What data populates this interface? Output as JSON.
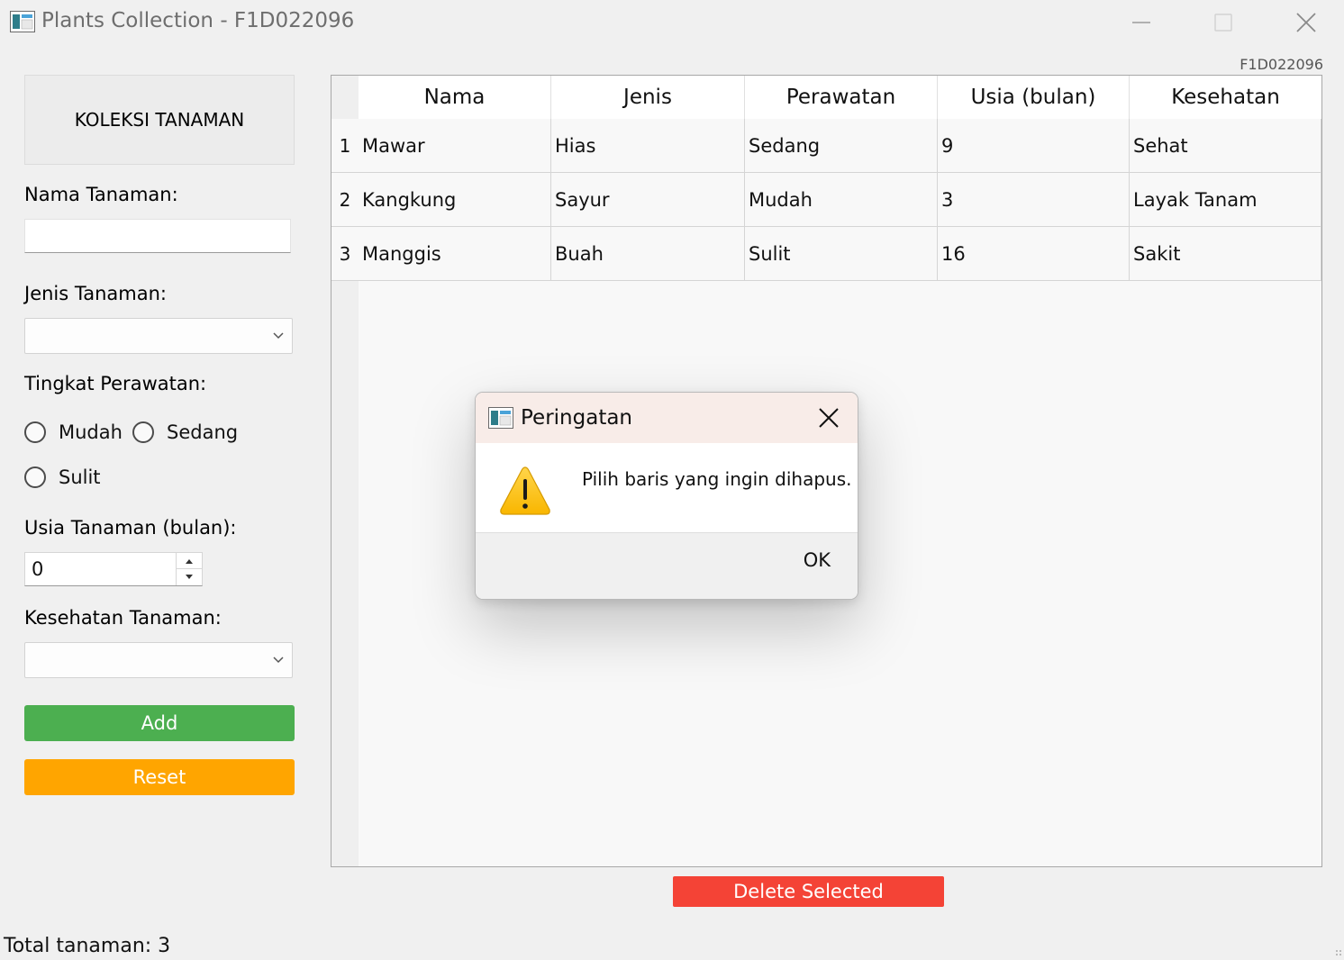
{
  "window": {
    "title": "Plants Collection - F1D022096",
    "icon": "app-window-icon"
  },
  "watermark": "F1D022096",
  "form": {
    "header": "KOLEKSI TANAMAN",
    "nama_label": "Nama Tanaman:",
    "nama_value": "",
    "jenis_label": "Jenis Tanaman:",
    "jenis_value": "",
    "perawatan_label": "Tingkat Perawatan:",
    "perawatan_options": [
      "Mudah",
      "Sedang",
      "Sulit"
    ],
    "usia_label": "Usia Tanaman (bulan):",
    "usia_value": "0",
    "kesehatan_label": "Kesehatan Tanaman:",
    "kesehatan_value": "",
    "add_label": "Add",
    "reset_label": "Reset"
  },
  "table": {
    "headers": [
      "Nama",
      "Jenis",
      "Perawatan",
      "Usia (bulan)",
      "Kesehatan"
    ],
    "rows": [
      {
        "num": "1",
        "nama": "Mawar",
        "jenis": "Hias",
        "perawatan": "Sedang",
        "usia": "9",
        "kesehatan": "Sehat"
      },
      {
        "num": "2",
        "nama": "Kangkung",
        "jenis": "Sayur",
        "perawatan": "Mudah",
        "usia": "3",
        "kesehatan": "Layak Tanam"
      },
      {
        "num": "3",
        "nama": "Manggis",
        "jenis": "Buah",
        "perawatan": "Sulit",
        "usia": "16",
        "kesehatan": "Sakit"
      }
    ]
  },
  "delete_label": "Delete Selected",
  "status": "Total tanaman: 3",
  "dialog": {
    "title": "Peringatan",
    "message": "Pilih baris yang ingin dihapus.",
    "ok_label": "OK"
  },
  "colors": {
    "add": "#4caf50",
    "reset": "#ffa500",
    "delete": "#f44336",
    "warning": "#ffc83d"
  }
}
